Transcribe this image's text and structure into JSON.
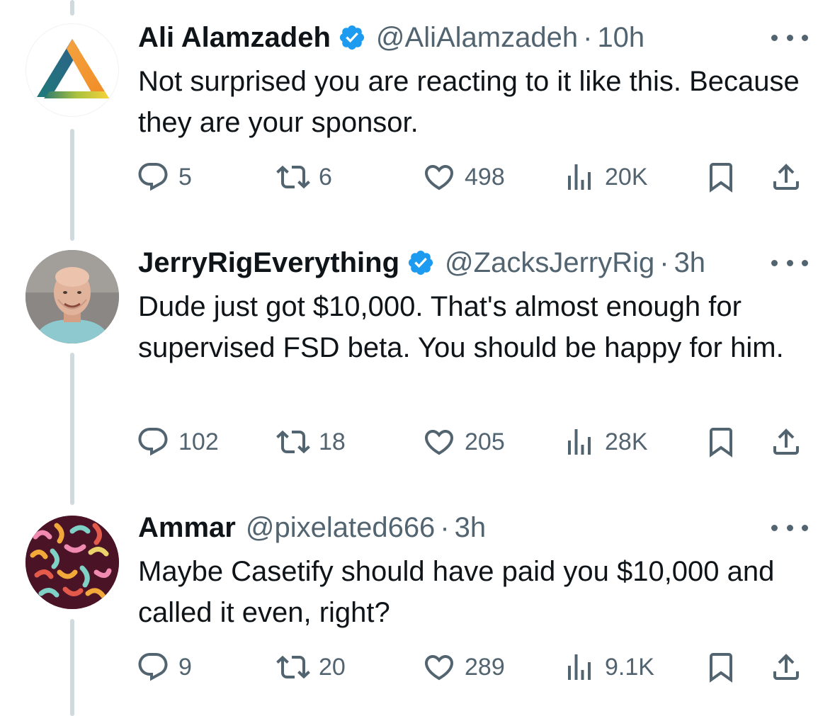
{
  "tweets": [
    {
      "name": "Ali Alamzadeh",
      "verified": true,
      "handle": "@AliAlamzadeh",
      "separator": "·",
      "time": "10h",
      "text": "Not surprised you are reacting to it like this. Because they are your sponsor.",
      "avatar_icon": "triangle-logo",
      "stats": {
        "replies": "5",
        "retweets": "6",
        "likes": "498",
        "views": "20K"
      }
    },
    {
      "name": "JerryRigEverything",
      "verified": true,
      "handle": "@ZacksJerryRig",
      "separator": "·",
      "time": "3h",
      "text": "Dude just got $10,000. That's almost enough for supervised FSD beta. You should be happy for him.",
      "avatar_icon": "person-photo",
      "stats": {
        "replies": "102",
        "retweets": "18",
        "likes": "205",
        "views": "28K"
      }
    },
    {
      "name": "Ammar",
      "verified": false,
      "handle": "@pixelated666",
      "separator": "·",
      "time": "3h",
      "text": "Maybe Casetify should have paid you $10,000 and called it even, right?",
      "avatar_icon": "colorful-squiggles-pattern",
      "stats": {
        "replies": "9",
        "retweets": "20",
        "likes": "289",
        "views": "9.1K"
      }
    }
  ],
  "colors": {
    "text": "#0f1419",
    "secondary": "#536471",
    "verified_badge": "#1d9bf0",
    "thread_line": "#cfd9de"
  }
}
